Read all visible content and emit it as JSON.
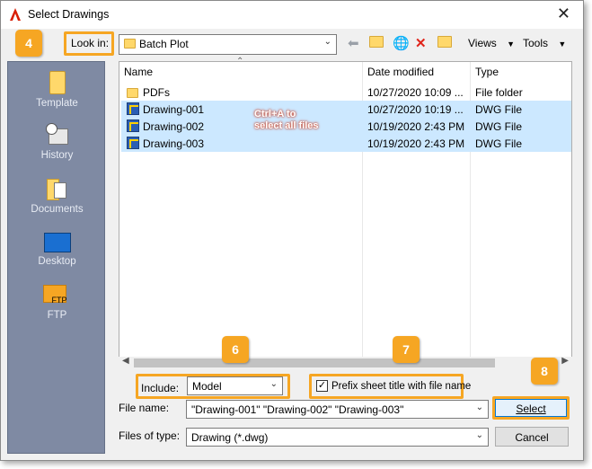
{
  "window": {
    "title": "Select Drawings"
  },
  "lookin": {
    "label": "Look in:",
    "value": "Batch Plot"
  },
  "toolbar": {
    "views": "Views",
    "tools": "Tools"
  },
  "places": [
    {
      "label": "Template"
    },
    {
      "label": "History"
    },
    {
      "label": "Documents"
    },
    {
      "label": "Desktop"
    },
    {
      "label": "FTP"
    }
  ],
  "ftp_icon_text": "FTP",
  "columns": {
    "name": "Name",
    "date": "Date modified",
    "type": "Type"
  },
  "files": [
    {
      "name": "PDFs",
      "date": "10/27/2020 10:09 ...",
      "type": "File folder"
    },
    {
      "name": "Drawing-001",
      "date": "10/27/2020 10:19 ...",
      "type": "DWG File"
    },
    {
      "name": "Drawing-002",
      "date": "10/19/2020 2:43 PM",
      "type": "DWG File"
    },
    {
      "name": "Drawing-003",
      "date": "10/19/2020 2:43 PM",
      "type": "DWG File"
    }
  ],
  "annotation": {
    "line1": "Ctrl+A to",
    "line2": "select all files"
  },
  "steps": {
    "s4": "4",
    "s6": "6",
    "s7": "7",
    "s8": "8"
  },
  "include": {
    "label": "Include:",
    "value": "Model"
  },
  "prefix": {
    "label": "Prefix sheet title with file name",
    "checked": true
  },
  "filename": {
    "label": "File name:",
    "value": "\"Drawing-001\" \"Drawing-002\" \"Drawing-003\""
  },
  "filetype": {
    "label": "Files of type:",
    "value": "Drawing (*.dwg)"
  },
  "buttons": {
    "select": "Select",
    "cancel": "Cancel"
  },
  "colors": {
    "highlight": "#f6a623",
    "selection": "#cce8ff",
    "places_bg": "#7f8aa3"
  }
}
